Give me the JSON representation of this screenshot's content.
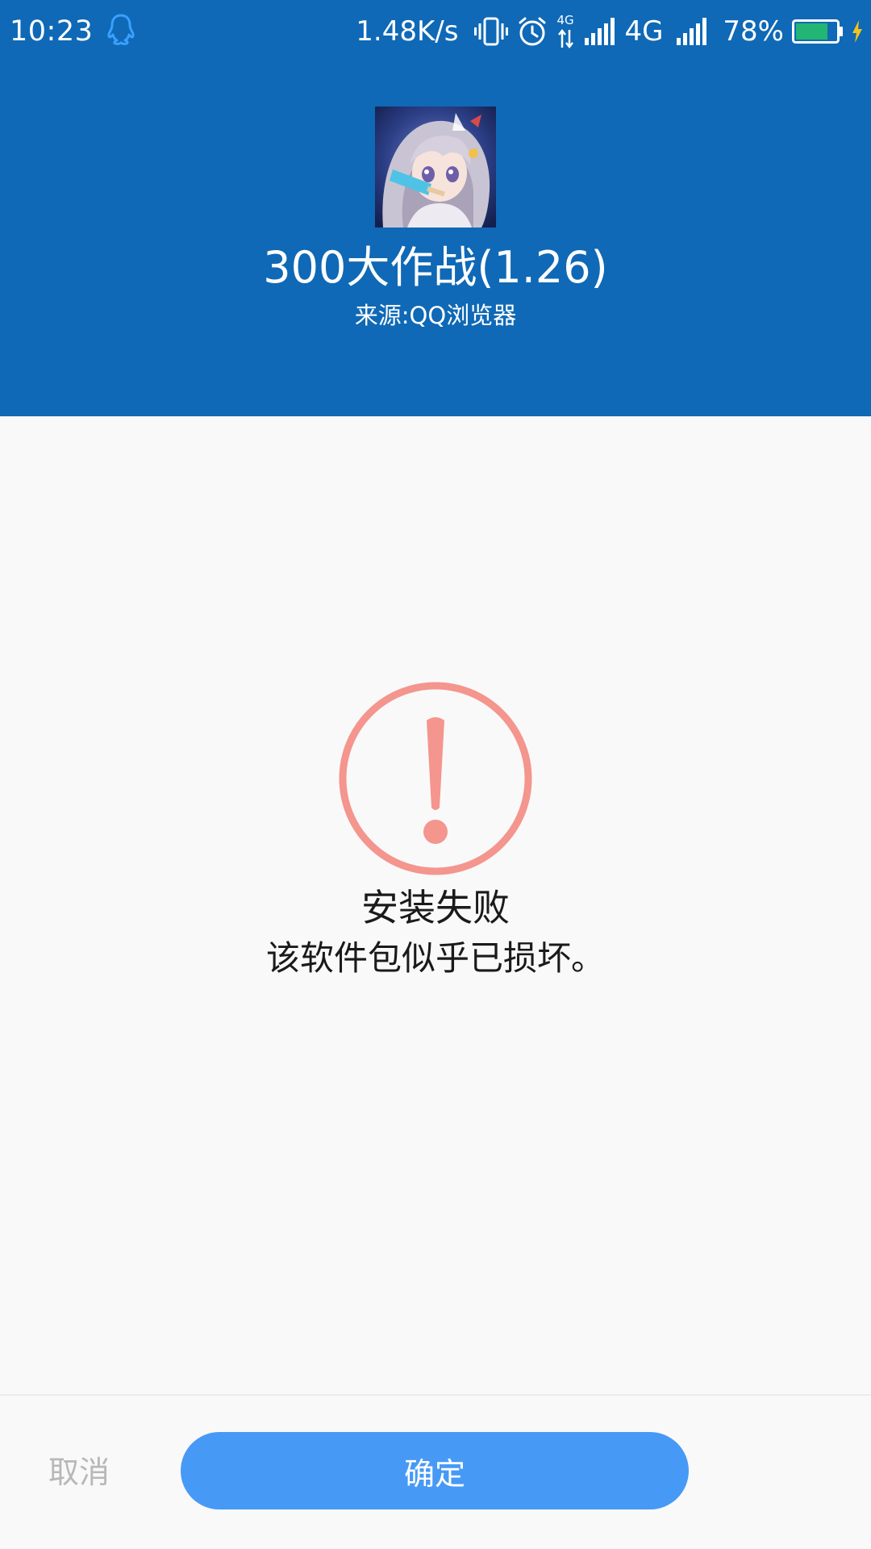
{
  "status_bar": {
    "time": "10:23",
    "net_speed": "1.48K/s",
    "network_type_small": "4G",
    "network_type": "4G",
    "battery_percent": "78%",
    "battery_level": 0.78,
    "icons": [
      "qq-icon",
      "vibrate-icon",
      "alarm-icon",
      "data-arrows-icon",
      "signal-icon",
      "signal-icon-2",
      "battery-icon",
      "charging-icon"
    ]
  },
  "app": {
    "name": "300大作战(1.26)",
    "source": "来源:QQ浏览器"
  },
  "result": {
    "title": "安装失败",
    "message": "该软件包似乎已损坏。",
    "icon": "warning-icon",
    "icon_color": "#f4958e"
  },
  "actions": {
    "cancel_label": "取消",
    "confirm_label": "确定"
  },
  "colors": {
    "header": "#0f69b6",
    "primary_button": "#4799f6",
    "background": "#f9f9f9"
  }
}
